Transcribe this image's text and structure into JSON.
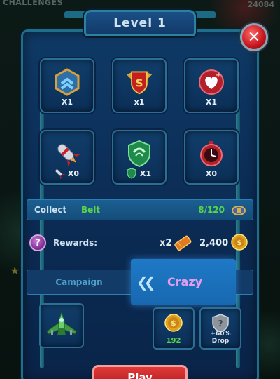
{
  "background": {
    "top_left_label": "CHALLENGES",
    "top_right_label": "24084"
  },
  "title": "Level 1",
  "close_icon": "close-x-icon",
  "items": [
    {
      "icon": "rank-chevron-icon",
      "count": "X1"
    },
    {
      "icon": "shield-s-badge-icon",
      "count": "x1"
    },
    {
      "icon": "heart-heal-icon",
      "count": "X1"
    },
    {
      "icon": "missile-icon",
      "count": "X0",
      "mini_icon": "missile-mini-icon"
    },
    {
      "icon": "green-shield-icon",
      "count": "X1",
      "mini_icon": "green-shield-mini-icon"
    },
    {
      "icon": "stopwatch-icon",
      "count": "X0"
    }
  ],
  "collect": {
    "label": "Collect",
    "item_name": "Belt",
    "progress": "8/120",
    "icon": "belt-icon"
  },
  "rewards": {
    "label": "Rewards:",
    "multiplier": "x2",
    "ticket_icon": "ticket-icon",
    "coins": "2,400",
    "coin_icon": "coin-icon"
  },
  "difficulty": {
    "options": [
      "Campaign",
      "Crazy"
    ],
    "selected": "Crazy"
  },
  "bonus": {
    "coins": "192",
    "drop": "+60% Drop"
  },
  "play_label": "Play",
  "colors": {
    "panel": "#0f3a66",
    "accent_green": "#5bd64a",
    "crazy_purple": "#e39cf0",
    "close_red": "#c4141c",
    "selected_blue": "#1f79c6"
  }
}
